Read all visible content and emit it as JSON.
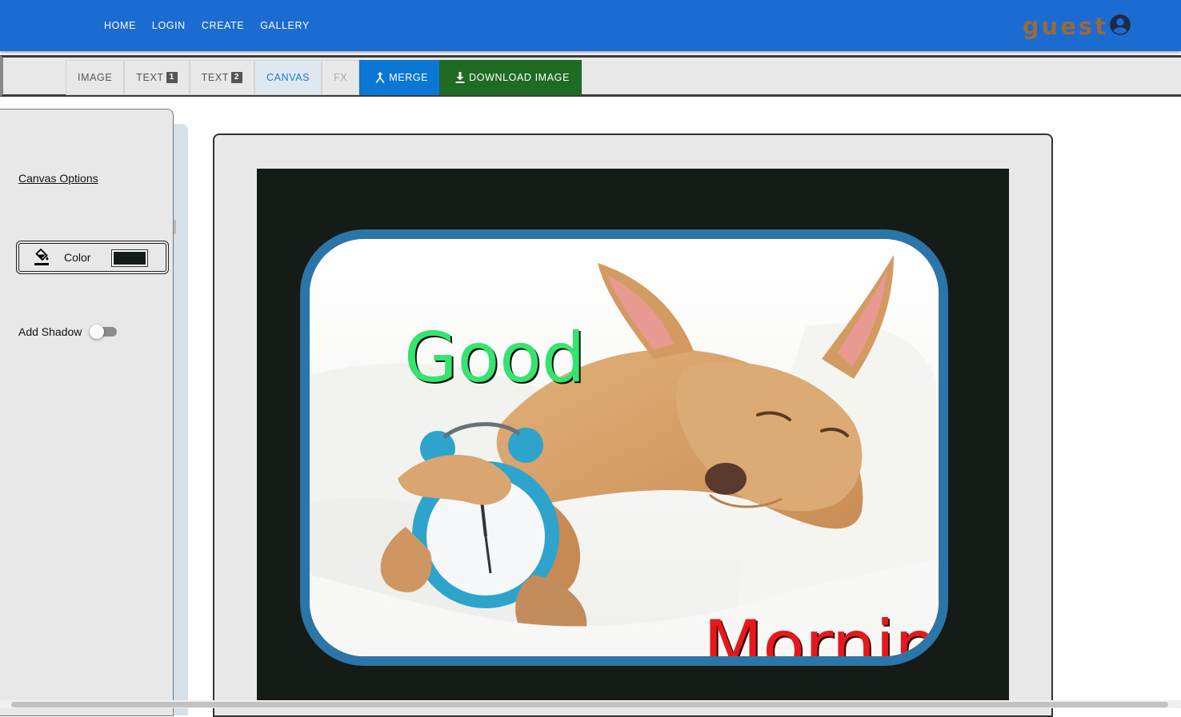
{
  "nav": {
    "home": "HOME",
    "login": "LOGIN",
    "create": "CREATE",
    "gallery": "GALLERY"
  },
  "user": {
    "name": "guest",
    "icon": "account-circle-icon"
  },
  "tabs": {
    "image": "IMAGE",
    "text1": "TEXT",
    "text1_num": "1",
    "text2": "TEXT",
    "text2_num": "2",
    "canvas": "CANVAS",
    "fx": "FX",
    "merge": "MERGE",
    "download": "DOWNLOAD IMAGE",
    "active": "CANVAS"
  },
  "panel": {
    "title": "Canvas Options",
    "color_label": "Color",
    "color_value": "#151b17",
    "shadow_label": "Add Shadow",
    "shadow_on": false
  },
  "meme": {
    "top_text": "Good",
    "bottom_text": "Morning",
    "top_color": "#35e36e",
    "bottom_color": "#e3191b",
    "frame_color": "#2b75a8",
    "background_color": "#151b17",
    "image_subject": "sleeping-dog-hugging-alarm-clock"
  },
  "colors": {
    "appbar": "#1b6bd0",
    "merge_button": "#0b77d4",
    "download_button": "#1f6b24",
    "active_tab_text": "#1b7bd0",
    "username": "#9a6a3a"
  }
}
